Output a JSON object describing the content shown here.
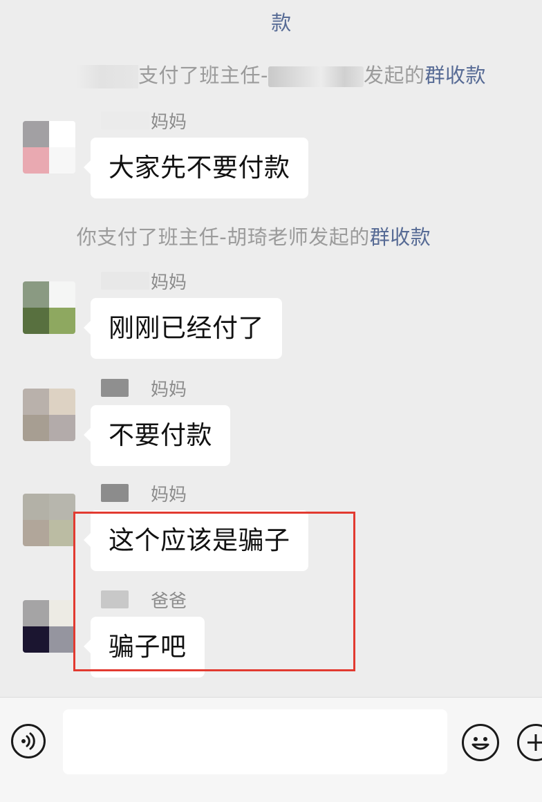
{
  "system_messages": {
    "top_partial": "款",
    "first": {
      "prefix": "支付了班主任-",
      "suffix": "发起的",
      "link": "群收款"
    },
    "second": {
      "text": "你支付了班主任-胡琦老师发起的",
      "link": "群收款"
    }
  },
  "messages": [
    {
      "sender": "妈妈",
      "text": "大家先不要付款",
      "avatar_colors": [
        "#a2a0a3",
        "#ffffff",
        "#e9a9b1",
        "#f7f7f7"
      ]
    },
    {
      "sender": "妈妈",
      "text": "刚刚已经付了",
      "avatar_colors": [
        "#8a9a82",
        "#f5f6f5",
        "#58703f",
        "#8ea860"
      ]
    },
    {
      "sender": "妈妈",
      "text": "不要付款",
      "avatar_colors": [
        "#b9b1ab",
        "#ddd2c3",
        "#a79e92",
        "#b3abaa"
      ]
    },
    {
      "sender": "妈妈",
      "text": "这个应该是骗子",
      "avatar_colors": [
        "#b3b1a7",
        "#b7b6ad",
        "#b1a69a",
        "#bbbca3"
      ]
    },
    {
      "sender": "爸爸",
      "text": "骗子吧",
      "avatar_colors": [
        "#a5a4a5",
        "#edebe4",
        "#1b1530",
        "#95959f"
      ]
    }
  ],
  "sender_blur_colors": [
    "#ebebeb",
    "#e8e8e8",
    "#8f8f8f",
    "#8c8c8c",
    "#c8c8c8"
  ],
  "colors": {
    "link": "#576b95",
    "system_text": "#9b9b9b",
    "highlight": "#e23a30"
  },
  "input_bar": {
    "voice_icon": "voice-icon",
    "emoji_icon": "emoji-icon",
    "plus_icon": "plus-icon"
  }
}
